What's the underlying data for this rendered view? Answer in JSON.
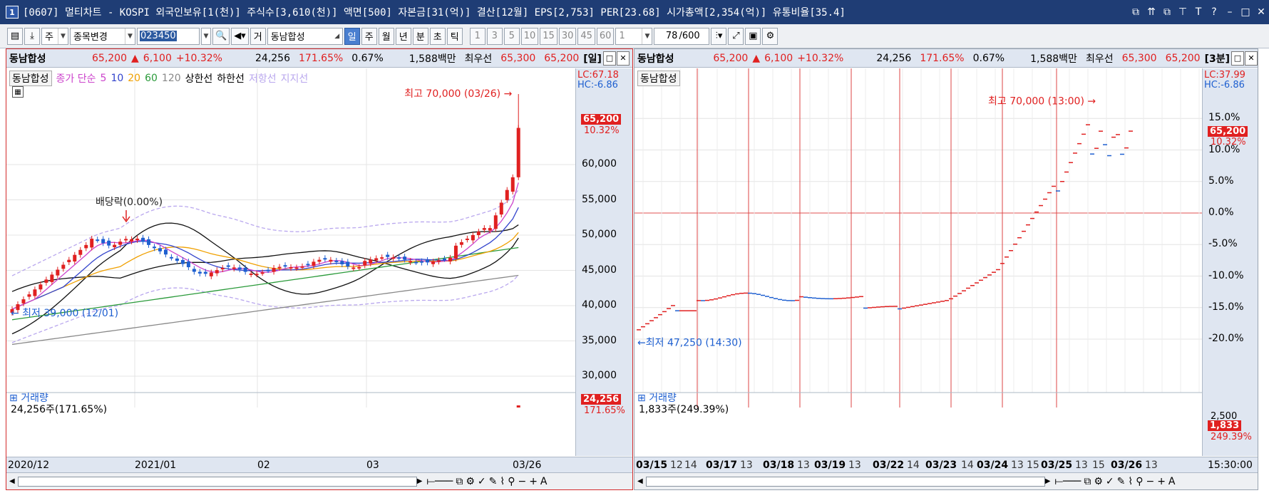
{
  "window": {
    "number": "1",
    "title": "[0607] 멀티차트 - KOSPI 외국인보유[1(천)] 주식수[3,610(천)] 액면[500] 자본금[31(억)] 결산[12월] EPS[2,753] PER[23.68] 시가총액[2,354(억)] 유통비율[35.4]",
    "buttons": [
      "⧉",
      "⇈",
      "⧉",
      "⊤",
      "T",
      "?",
      "–",
      "□",
      "✕"
    ]
  },
  "toolbar": {
    "stock_type": "주",
    "change_label": "종목변경",
    "code": "023450",
    "mode_label": "거",
    "stock_name": "동남합성",
    "periods": [
      "일",
      "주",
      "월",
      "년",
      "분",
      "초",
      "틱"
    ],
    "selected_period": "일",
    "intervals": [
      "1",
      "3",
      "5",
      "10",
      "15",
      "30",
      "45",
      "60"
    ],
    "count_value": "1",
    "page_value": "78",
    "page_total": "/600"
  },
  "left": {
    "header": {
      "name": "동남합성",
      "price": "65,200",
      "arrow": "▲",
      "change": "6,100",
      "rate": "+10.32%",
      "volume": "24,256",
      "vol_ratio": "171.65%",
      "turnover": "0.67%",
      "amount": "1,588백만",
      "bid_label": "최우선",
      "ask": "65,300",
      "bid": "65,200",
      "period": "[일]"
    },
    "legend": {
      "name": "동남합성",
      "close_label": "종가 단순",
      "ma": [
        "5",
        "10",
        "20",
        "60",
        "120"
      ],
      "upper": "상한선",
      "lower": "하한선",
      "resist": "저항선",
      "support": "지지선"
    },
    "lc": "LC:67.18",
    "hc": "HC:-6.86",
    "price_badge": "65,200",
    "pct_badge": "10.32%",
    "high_label": "최고 70,000 (03/26)",
    "low_label": "최저 39,000 (12/01)",
    "dividend_label": "배당락(0.00%)",
    "volume_title": "거래량",
    "volume_text": "24,256주(171.65%)",
    "vol_badge": "24,256",
    "vol_pct": "171.65%",
    "x_labels": [
      "2020/12",
      "2021/01",
      "02",
      "03",
      "03/26"
    ],
    "y_labels": [
      "60,000",
      "55,000",
      "50,000",
      "45,000",
      "40,000",
      "35,000",
      "30,000"
    ]
  },
  "right": {
    "header": {
      "name": "동남합성",
      "price": "65,200",
      "arrow": "▲",
      "change": "6,100",
      "rate": "+10.32%",
      "volume": "24,256",
      "vol_ratio": "171.65%",
      "turnover": "0.67%",
      "amount": "1,588백만",
      "bid_label": "최우선",
      "ask": "65,300",
      "bid": "65,200",
      "period": "[3분]"
    },
    "legend": {
      "name": "동남합성"
    },
    "lc": "LC:37.99",
    "hc": "HC:-6.86",
    "price_badge": "65,200",
    "pct_badge": "10.32%",
    "high_label": "최고 70,000 (13:00)",
    "low_label": "최저 47,250 (14:30)",
    "volume_title": "거래량",
    "volume_text": "1,833주(249.39%)",
    "vol_badge": "1,833",
    "vol_pct": "249.39%",
    "vol_tick": "2,500",
    "x_labels": [
      "03/15",
      "12",
      "14",
      "03/17",
      "13",
      "03/18",
      "13",
      "03/19",
      "13",
      "03/22",
      "14",
      "03/23",
      "14",
      "03/24",
      "13",
      "15",
      "03/25",
      "13",
      "15",
      "03/26",
      "13"
    ],
    "time_label": "15:30:00",
    "y_labels": [
      "15.0%",
      "10.0%",
      "5.0%",
      "0.0%",
      "-5.0%",
      "-10.0%",
      "-15.0%",
      "-20.0%"
    ]
  },
  "colors": {
    "up": "#e02020",
    "down": "#1e5fd0",
    "ma5": "#cc44cc",
    "ma10": "#3344cc",
    "ma20": "#f0a000",
    "ma60": "#2a9a3a",
    "ma120": "#888888",
    "band": "#b9a7ee"
  }
}
